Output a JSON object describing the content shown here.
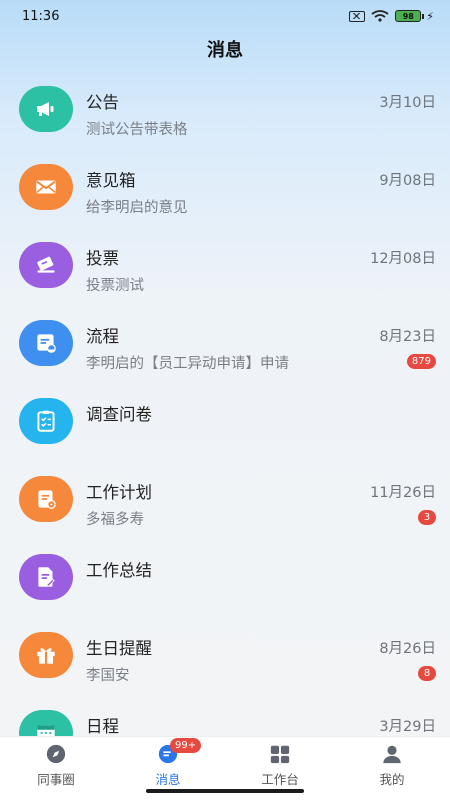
{
  "status_bar": {
    "time": "11:36",
    "battery": "98"
  },
  "header": {
    "title": "消息"
  },
  "messages": [
    {
      "title": "公告",
      "date": "3月10日",
      "subtitle": "测试公告带表格",
      "badge": "",
      "icon": "megaphone-icon",
      "color": "#2cc0a5"
    },
    {
      "title": "意见箱",
      "date": "9月08日",
      "subtitle": "给李明启的意见",
      "badge": "",
      "icon": "envelope-icon",
      "color": "#f5883a"
    },
    {
      "title": "投票",
      "date": "12月08日",
      "subtitle": "投票测试",
      "badge": "",
      "icon": "ballot-icon",
      "color": "#9a5ee0"
    },
    {
      "title": "流程",
      "date": "8月23日",
      "subtitle": "李明启的【员工异动申请】申请",
      "badge": "879",
      "icon": "process-doc-icon",
      "color": "#3f8ff0"
    },
    {
      "title": "调查问卷",
      "date": "",
      "subtitle": "",
      "badge": "",
      "icon": "checklist-icon",
      "color": "#26b4ee"
    },
    {
      "title": "工作计划",
      "date": "11月26日",
      "subtitle": "多福多寿",
      "badge": "3",
      "icon": "plan-doc-icon",
      "color": "#f5883a"
    },
    {
      "title": "工作总结",
      "date": "",
      "subtitle": "",
      "badge": "",
      "icon": "edit-doc-icon",
      "color": "#9a5ee0"
    },
    {
      "title": "生日提醒",
      "date": "8月26日",
      "subtitle": "李国安",
      "badge": "8",
      "icon": "gift-icon",
      "color": "#f5883a"
    },
    {
      "title": "日程",
      "date": "3月29日",
      "subtitle": "",
      "badge": "",
      "icon": "calendar-icon",
      "color": "#2cc0a5"
    }
  ],
  "tabbar": {
    "tabs": [
      {
        "label": "同事圈",
        "icon": "compass-icon"
      },
      {
        "label": "消息",
        "icon": "chat-icon",
        "badge": "99+"
      },
      {
        "label": "工作台",
        "icon": "grid-icon"
      },
      {
        "label": "我的",
        "icon": "person-icon"
      }
    ],
    "active_color": "#2b77e6"
  }
}
